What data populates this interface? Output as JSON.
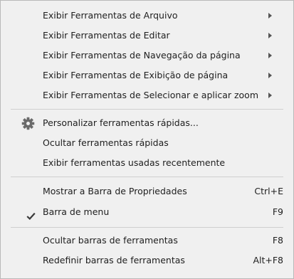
{
  "menu": {
    "submenus": [
      {
        "label": "Exibir Ferramentas de Arquivo"
      },
      {
        "label": "Exibir Ferramentas de Editar"
      },
      {
        "label": "Exibir Ferramentas de Navegação da página"
      },
      {
        "label": "Exibir Ferramentas de Exibição de página"
      },
      {
        "label": "Exibir Ferramentas de Selecionar e aplicar zoom"
      }
    ],
    "tools": [
      {
        "label": "Personalizar ferramentas rápidas...",
        "icon": "gear-icon"
      },
      {
        "label": "Ocultar ferramentas rápidas"
      },
      {
        "label": "Exibir ferramentas usadas recentemente"
      }
    ],
    "view": [
      {
        "label": "Mostrar a Barra de Propriedades",
        "shortcut": "Ctrl+E"
      },
      {
        "label": "Barra de menu",
        "shortcut": "F9",
        "checked": true,
        "icon": "checkmark-icon"
      }
    ],
    "toolbars": [
      {
        "label": "Ocultar barras de ferramentas",
        "shortcut": "F8"
      },
      {
        "label": "Redefinir barras de ferramentas",
        "shortcut": "Alt+F8"
      }
    ]
  }
}
